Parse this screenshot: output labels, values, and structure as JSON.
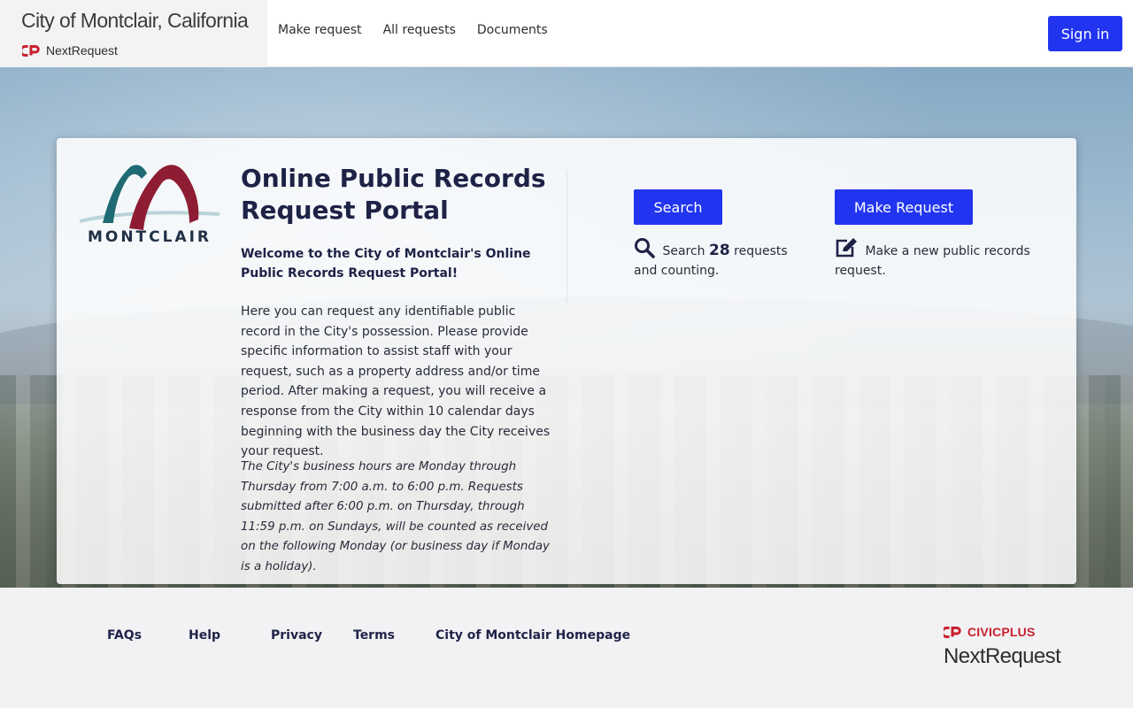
{
  "header": {
    "site_title": "City of Montclair, California",
    "product_name": "NextRequest",
    "nav": [
      "Make request",
      "All requests",
      "Documents"
    ],
    "sign_in_label": "Sign in"
  },
  "card": {
    "logo_text": "MONTCLAIR",
    "title": "Online Public Records Request Portal",
    "welcome": "Welcome to the City of Montclair's Online Public Records Request Portal!",
    "intro": "Here you can request any identifiable public record in the City's possession. Please provide specific information to assist staff with your request, such as a property address and/or time period. After making a request, you will receive a response from the City within 10 calendar days beginning with the business day the City receives your request.",
    "hours": "The City's business hours are Monday through Thursday from 7:00 a.m. to 6:00 p.m. Requests submitted after 6:00 p.m. on Thursday, through 11:59 p.m. on Sundays, will be counted as received on the following Monday (or business day if Monday is a holiday).",
    "search": {
      "button_label": "Search",
      "text_before": "Search",
      "count": "28",
      "text_after": "requests and counting.",
      "icon": "search-icon"
    },
    "make_request": {
      "button_label": "Make Request",
      "text": "Make a new public records request.",
      "icon": "edit-icon"
    }
  },
  "footer": {
    "links": [
      "FAQs",
      "Help",
      "Privacy",
      "Terms",
      "City of Montclair Homepage"
    ],
    "vendor": "CIVICPLUS",
    "product": "NextRequest"
  },
  "colors": {
    "primary_button": "#2135f0",
    "heading_text": "#1e2246",
    "civicplus_red": "#c9202f",
    "logo_teal": "#1f6b73",
    "logo_maroon": "#8e1d33"
  }
}
